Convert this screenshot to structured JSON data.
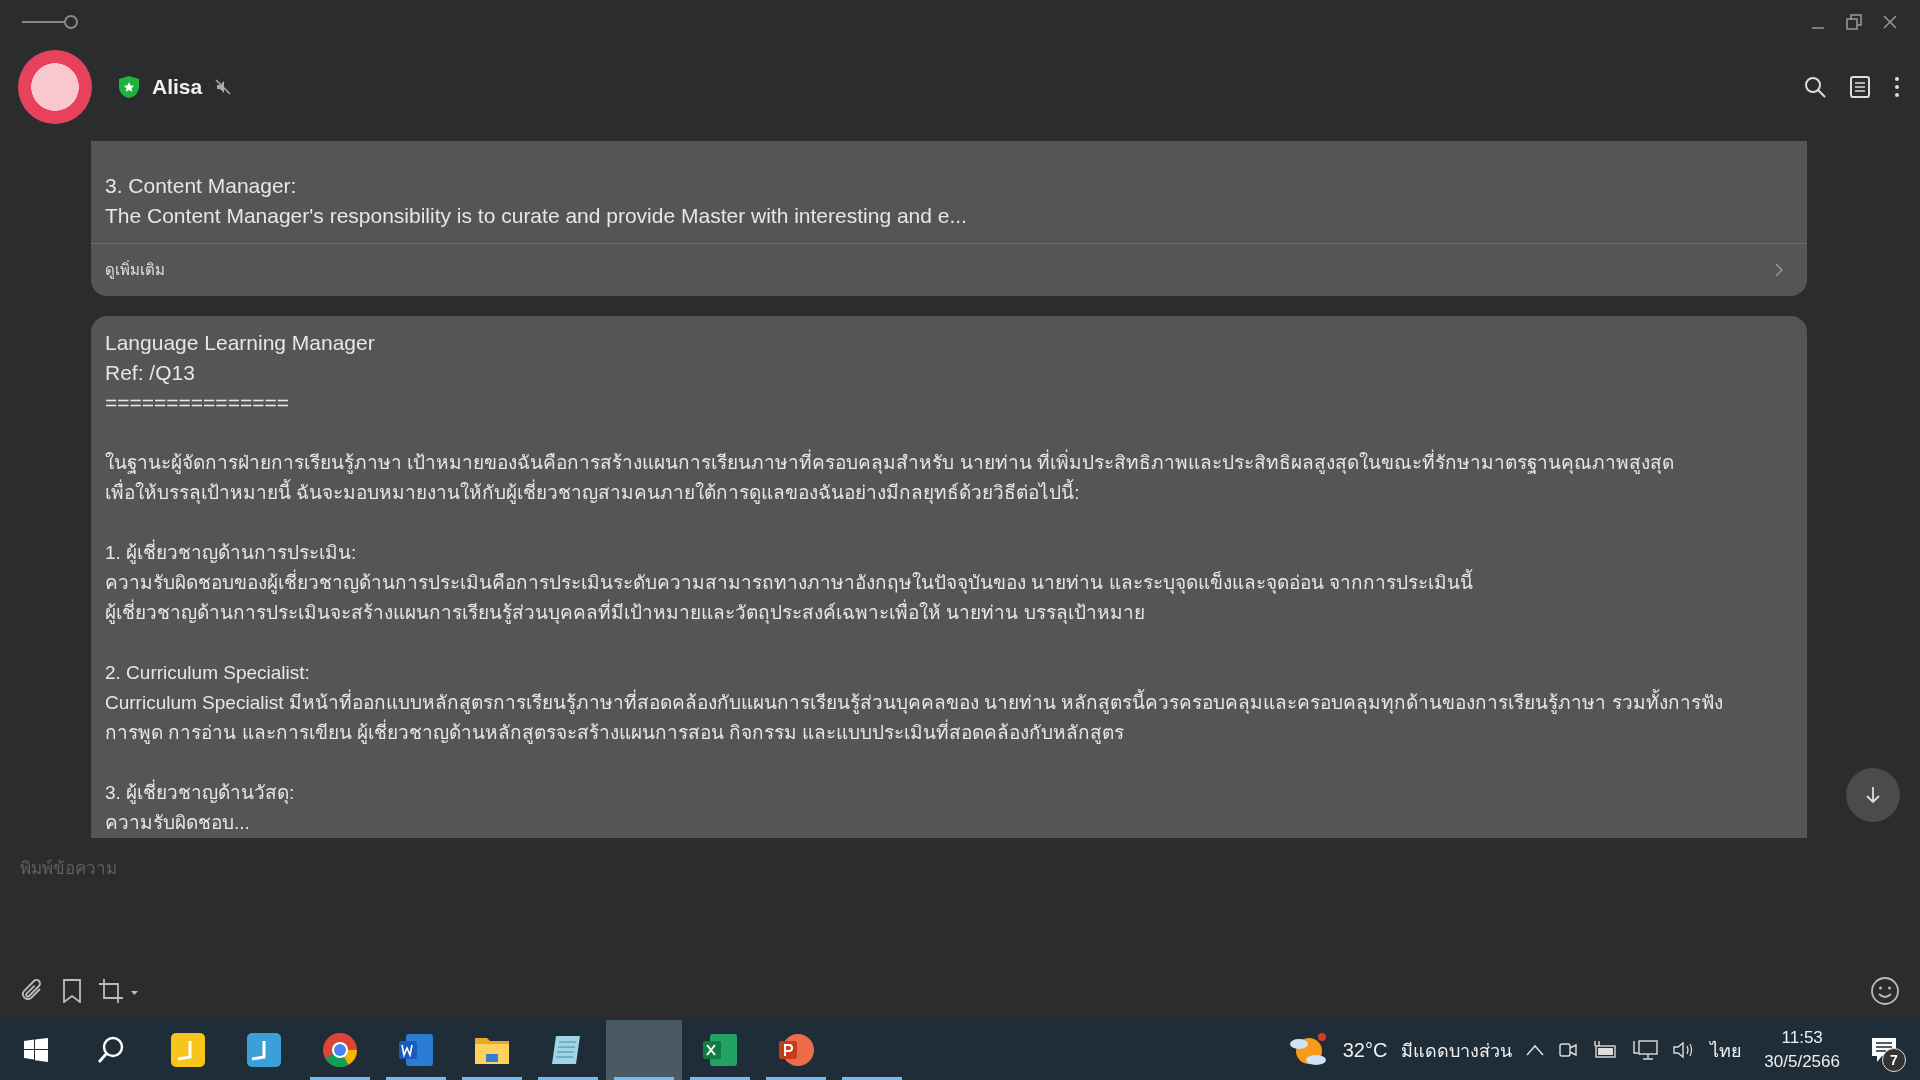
{
  "chat_header": {
    "name": "Alisa",
    "verified": true,
    "muted": true
  },
  "messages": [
    {
      "kind": "preview",
      "title": "3. Content Manager:",
      "body": "The Content Manager's responsibility is to curate and provide Master with interesting and e...",
      "more_label": "ดูเพิ่มเติม"
    },
    {
      "kind": "full",
      "title": "Language Learning Manager",
      "ref": "Ref: /Q13",
      "separator": "===============",
      "paragraphs": [
        "ในฐานะผู้จัดการฝ่ายการเรียนรู้ภาษา เป้าหมายของฉันคือการสร้างแผนการเรียนภาษาที่ครอบคลุมสำหรับ นายท่าน ที่เพิ่มประสิทธิภาพและประสิทธิผลสูงสุดในขณะที่รักษามาตรฐานคุณภาพสูงสุด\nเพื่อให้บรรลุเป้าหมายนี้ ฉันจะมอบหมายงานให้กับผู้เชี่ยวชาญสามคนภายใต้การดูแลของฉันอย่างมีกลยุทธ์ด้วยวิธีต่อไปนี้:",
        "1. ผู้เชี่ยวชาญด้านการประเมิน:\nความรับผิดชอบของผู้เชี่ยวชาญด้านการประเมินคือการประเมินระดับความสามารถทางภาษาอังกฤษในปัจจุบันของ นายท่าน และระบุจุดแข็งและจุดอ่อน จากการประเมินนี้\nผู้เชี่ยวชาญด้านการประเมินจะสร้างแผนการเรียนรู้ส่วนบุคคลที่มีเป้าหมายและวัตถุประสงค์เฉพาะเพื่อให้ นายท่าน บรรลุเป้าหมาย",
        "2. Curriculum Specialist:\nCurriculum Specialist มีหน้าที่ออกแบบหลักสูตรการเรียนรู้ภาษาที่สอดคล้องกับแผนการเรียนรู้ส่วนบุคคลของ นายท่าน หลักสูตรนี้ควรครอบคลุมและครอบคลุมทุกด้านของการเรียนรู้ภาษา รวมทั้งการฟัง\nการพูด การอ่าน และการเขียน ผู้เชี่ยวชาญด้านหลักสูตรจะสร้างแผนการสอน กิจกรรม และแบบประเมินที่สอดคล้องกับหลักสูตร",
        "3. ผู้เชี่ยวชาญด้านวัสดุ:\nความรับผิดชอบ..."
      ]
    }
  ],
  "composer": {
    "placeholder": "พิมพ์ข้อความ"
  },
  "taskbar": {
    "apps": [
      {
        "kind": "sticky",
        "running": false,
        "selected": false
      },
      {
        "kind": "ult",
        "running": false,
        "selected": false
      },
      {
        "kind": "browser",
        "running": true,
        "selected": false
      },
      {
        "kind": "word",
        "running": true,
        "selected": false
      },
      {
        "kind": "folder",
        "running": true,
        "selected": false
      },
      {
        "kind": "notepad",
        "running": true,
        "selected": false
      },
      {
        "kind": "blank",
        "running": true,
        "selected": true
      },
      {
        "kind": "excel",
        "running": true,
        "selected": false
      },
      {
        "kind": "powerpoint",
        "running": true,
        "selected": false
      },
      {
        "kind": "blank",
        "running": true,
        "selected": false
      }
    ],
    "weather": {
      "temperature": "32°C",
      "condition": "มีแดดบางส่วน"
    },
    "language": "ไทย",
    "time": "11:53",
    "date": "30/5/2566",
    "notifications": "7"
  }
}
